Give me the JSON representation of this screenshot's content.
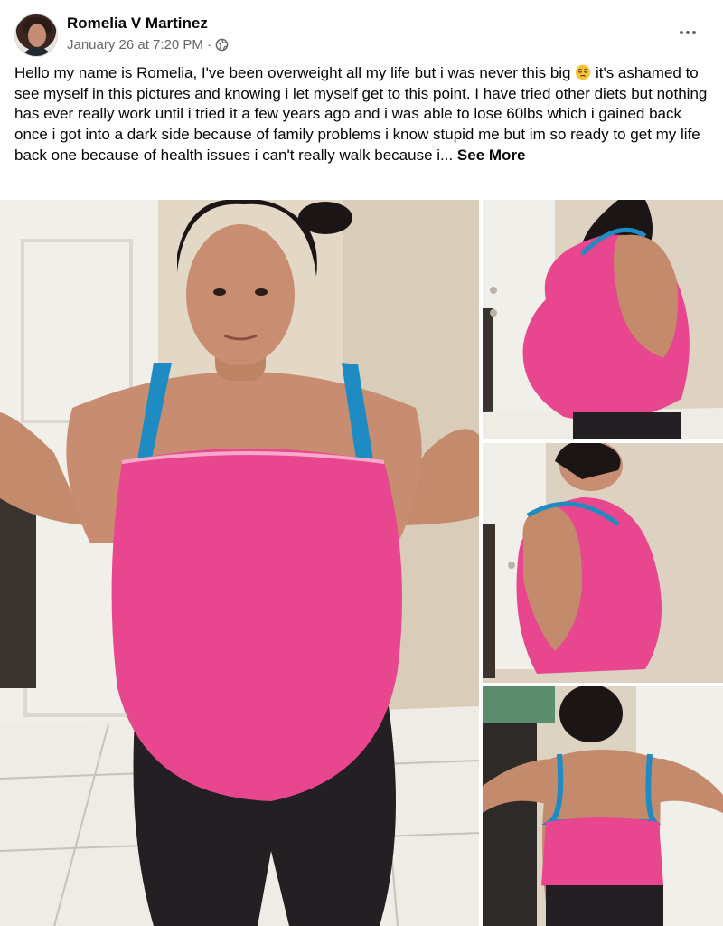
{
  "post": {
    "author": "Romelia V Martinez",
    "timestamp": "January 26 at 7:20 PM",
    "separator": "·",
    "privacy_icon": "globe-icon",
    "menu_icon": "more-horizontal-icon",
    "text_before_emoji": "Hello my name is Romelia, I've been overweight all my life but i was never this big ",
    "emoji": "pensive-face-emoji",
    "text_after_emoji": " it's ashamed to see myself in this pictures and knowing i let myself get to this point. I have tried other diets but nothing has ever really work until i tried it a few years ago and i was able to lose 60lbs which i gained back once i got into a dark side because of family problems i know stupid me but im so ready to get my life back one because of health issues i can't really walk because i... ",
    "see_more_label": "See More"
  },
  "photos": [
    {
      "view": "front"
    },
    {
      "view": "side"
    },
    {
      "view": "side"
    },
    {
      "view": "back"
    }
  ],
  "colors": {
    "text_primary": "#050505",
    "text_secondary": "#65676b",
    "top_pink": "#e8468e",
    "strap_blue": "#1e8bc3",
    "wall": "#e6dccb",
    "door": "#f2f0ec"
  }
}
